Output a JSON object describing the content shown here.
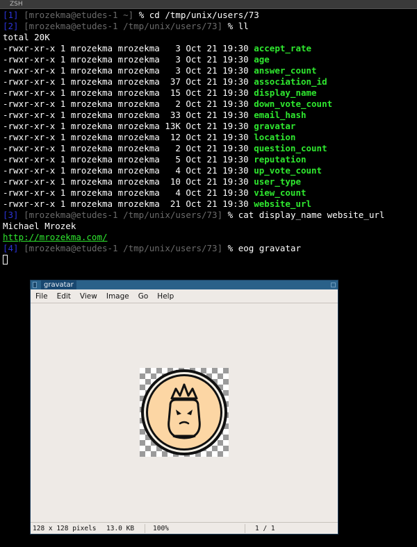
{
  "window_title": "ZSH",
  "prompts": [
    {
      "num": "[1]",
      "host": "[mrozekma@etudes-1",
      "dir": "~]",
      "symbol": "%",
      "cmd": "cd /tmp/unix/users/73"
    },
    {
      "num": "[2]",
      "host": "[mrozekma@etudes-1",
      "dir": "/tmp/unix/users/73]",
      "symbol": "%",
      "cmd": "ll"
    },
    {
      "num": "[3]",
      "host": "[mrozekma@etudes-1",
      "dir": "/tmp/unix/users/73]",
      "symbol": "%",
      "cmd": "cat display_name website_url"
    },
    {
      "num": "[4]",
      "host": "[mrozekma@etudes-1",
      "dir": "/tmp/unix/users/73]",
      "symbol": "%",
      "cmd": "eog gravatar"
    }
  ],
  "total_line": "total 20K",
  "files": [
    {
      "perm": "-rwxr-xr-x",
      "links": "1",
      "owner": "mrozekma",
      "group": "mrozekma",
      "size": "3",
      "date": "Oct 21 19:30",
      "name": "accept_rate"
    },
    {
      "perm": "-rwxr-xr-x",
      "links": "1",
      "owner": "mrozekma",
      "group": "mrozekma",
      "size": "3",
      "date": "Oct 21 19:30",
      "name": "age"
    },
    {
      "perm": "-rwxr-xr-x",
      "links": "1",
      "owner": "mrozekma",
      "group": "mrozekma",
      "size": "3",
      "date": "Oct 21 19:30",
      "name": "answer_count"
    },
    {
      "perm": "-rwxr-xr-x",
      "links": "1",
      "owner": "mrozekma",
      "group": "mrozekma",
      "size": "37",
      "date": "Oct 21 19:30",
      "name": "association_id"
    },
    {
      "perm": "-rwxr-xr-x",
      "links": "1",
      "owner": "mrozekma",
      "group": "mrozekma",
      "size": "15",
      "date": "Oct 21 19:30",
      "name": "display_name"
    },
    {
      "perm": "-rwxr-xr-x",
      "links": "1",
      "owner": "mrozekma",
      "group": "mrozekma",
      "size": "2",
      "date": "Oct 21 19:30",
      "name": "down_vote_count"
    },
    {
      "perm": "-rwxr-xr-x",
      "links": "1",
      "owner": "mrozekma",
      "group": "mrozekma",
      "size": "33",
      "date": "Oct 21 19:30",
      "name": "email_hash"
    },
    {
      "perm": "-rwxr-xr-x",
      "links": "1",
      "owner": "mrozekma",
      "group": "mrozekma",
      "size": "13K",
      "date": "Oct 21 19:30",
      "name": "gravatar"
    },
    {
      "perm": "-rwxr-xr-x",
      "links": "1",
      "owner": "mrozekma",
      "group": "mrozekma",
      "size": "12",
      "date": "Oct 21 19:30",
      "name": "location"
    },
    {
      "perm": "-rwxr-xr-x",
      "links": "1",
      "owner": "mrozekma",
      "group": "mrozekma",
      "size": "2",
      "date": "Oct 21 19:30",
      "name": "question_count"
    },
    {
      "perm": "-rwxr-xr-x",
      "links": "1",
      "owner": "mrozekma",
      "group": "mrozekma",
      "size": "5",
      "date": "Oct 21 19:30",
      "name": "reputation"
    },
    {
      "perm": "-rwxr-xr-x",
      "links": "1",
      "owner": "mrozekma",
      "group": "mrozekma",
      "size": "4",
      "date": "Oct 21 19:30",
      "name": "up_vote_count"
    },
    {
      "perm": "-rwxr-xr-x",
      "links": "1",
      "owner": "mrozekma",
      "group": "mrozekma",
      "size": "10",
      "date": "Oct 21 19:30",
      "name": "user_type"
    },
    {
      "perm": "-rwxr-xr-x",
      "links": "1",
      "owner": "mrozekma",
      "group": "mrozekma",
      "size": "4",
      "date": "Oct 21 19:30",
      "name": "view_count"
    },
    {
      "perm": "-rwxr-xr-x",
      "links": "1",
      "owner": "mrozekma",
      "group": "mrozekma",
      "size": "21",
      "date": "Oct 21 19:30",
      "name": "website_url"
    }
  ],
  "cat_output": {
    "display_name": "Michael Mrozek",
    "website_url": "http://mrozekma.com/"
  },
  "eog": {
    "title": "gravatar",
    "menu": [
      "File",
      "Edit",
      "View",
      "Image",
      "Go",
      "Help"
    ],
    "status": {
      "dimensions": "128 x 128 pixels",
      "size": "13.0 KB",
      "zoom": "100%",
      "page": "1 / 1"
    }
  },
  "colors": {
    "prompt_number": "#2c34d8",
    "prompt_host": "#6b6b6b",
    "file_name": "#2fe82f",
    "avatar_fill": "#fcd6a4"
  },
  "icons": {
    "avatar": "crowned-cat-avatar-icon"
  }
}
